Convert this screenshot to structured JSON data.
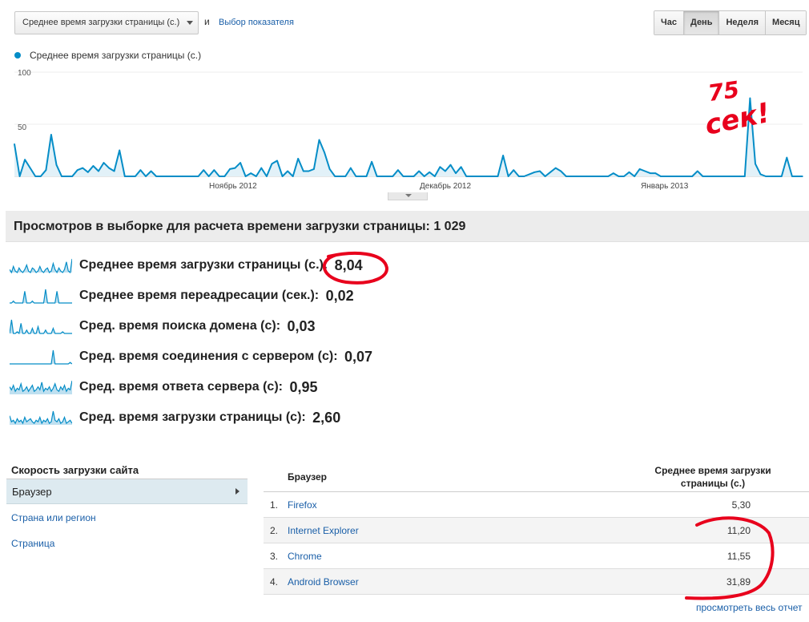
{
  "toolbar": {
    "metric_select": "Среднее время загрузки страницы (с.)",
    "and": "и",
    "choose_metric": "Выбор показателя",
    "periods": [
      "Час",
      "День",
      "Неделя",
      "Месяц"
    ],
    "active_period": "День"
  },
  "chart": {
    "legend": "Среднее время загрузки страницы (с.)",
    "series_color": "#058dc7",
    "fill_color": "#e2f1f8",
    "chart_data": {
      "type": "area",
      "series": [
        {
          "name": "Среднее время загрузки страницы (с.)",
          "values": [
            31,
            0,
            16,
            8,
            0,
            0,
            6,
            40,
            11,
            0,
            0,
            0,
            6,
            8,
            4,
            10,
            5,
            13,
            8,
            5,
            25,
            0,
            0,
            0,
            6,
            0,
            5,
            0,
            0,
            0,
            0,
            0,
            0,
            0,
            0,
            0,
            6,
            0,
            6,
            0,
            0,
            7,
            8,
            13,
            0,
            3,
            0,
            8,
            0,
            12,
            15,
            0,
            5,
            0,
            17,
            5,
            5,
            7,
            35,
            23,
            7,
            0,
            0,
            0,
            8,
            0,
            0,
            0,
            14,
            0,
            0,
            0,
            0,
            6,
            0,
            0,
            0,
            5,
            0,
            4,
            0,
            9,
            5,
            11,
            3,
            9,
            0,
            0,
            0,
            0,
            0,
            0,
            0,
            20,
            0,
            6,
            0,
            0,
            2,
            4,
            5,
            0,
            4,
            8,
            5,
            0,
            0,
            0,
            0,
            0,
            0,
            0,
            0,
            0,
            3,
            0,
            0,
            4,
            0,
            7,
            5,
            3,
            3,
            0,
            0,
            0,
            0,
            0,
            0,
            0,
            5,
            0,
            0,
            0,
            0,
            0,
            0,
            0,
            0,
            0,
            75,
            12,
            2,
            0,
            0,
            0,
            0,
            18,
            0,
            0,
            0
          ]
        }
      ],
      "ylim": [
        0,
        100
      ],
      "yticks": [
        "100",
        "50"
      ],
      "xticks": [
        "Ноябрь 2012",
        "Декабрь 2012",
        "Январь 2013"
      ]
    }
  },
  "views_header": "Просмотров в выборке для расчета времени загрузки страницы: 1 029",
  "metrics": [
    {
      "label": "Среднее время загрузки страницы (с.): ",
      "value": "8,04",
      "spark": [
        2,
        0,
        4,
        1,
        0,
        3,
        1,
        0,
        2,
        5,
        1,
        0,
        3,
        2,
        0,
        1,
        4,
        1,
        0,
        2,
        3,
        0,
        1,
        6,
        2,
        0,
        3,
        1,
        0,
        2,
        7,
        1,
        0,
        9
      ]
    },
    {
      "label": "Среднее время переадресации (сек.): ",
      "value": "0,02",
      "spark": [
        0,
        0,
        1,
        0,
        0,
        0,
        0,
        0,
        6,
        0,
        0,
        0,
        1,
        0,
        0,
        0,
        0,
        0,
        0,
        7,
        0,
        0,
        0,
        0,
        0,
        6,
        0,
        0,
        0,
        0,
        0,
        0,
        0,
        0
      ]
    },
    {
      "label": "Сред. время поиска домена (с): ",
      "value": "0,03",
      "spark": [
        0,
        8,
        0,
        0,
        1,
        0,
        6,
        0,
        0,
        2,
        0,
        0,
        3,
        0,
        0,
        4,
        0,
        0,
        0,
        2,
        0,
        0,
        0,
        3,
        0,
        0,
        0,
        0,
        1,
        0,
        0,
        0,
        0,
        0
      ]
    },
    {
      "label": "Сред. время соединения с сервером (с): ",
      "value": "0,07",
      "spark": [
        0,
        0,
        0,
        0,
        0,
        0,
        0,
        0,
        0,
        0,
        0,
        0,
        0,
        0,
        0,
        0,
        0,
        0,
        0,
        0,
        0,
        0,
        0,
        9,
        0,
        0,
        0,
        0,
        0,
        0,
        0,
        0,
        1,
        0
      ]
    },
    {
      "label": "Сред. время ответа сервера (с): ",
      "value": "0,95",
      "spark": [
        5,
        3,
        6,
        2,
        4,
        3,
        7,
        2,
        3,
        5,
        2,
        4,
        6,
        2,
        3,
        5,
        3,
        8,
        2,
        4,
        3,
        5,
        2,
        4,
        7,
        3,
        2,
        5,
        3,
        6,
        2,
        4,
        3,
        9
      ]
    },
    {
      "label": "Сред. время загрузки страницы (с): ",
      "value": "2,60",
      "spark": [
        6,
        2,
        3,
        1,
        4,
        2,
        3,
        1,
        5,
        2,
        3,
        4,
        2,
        1,
        3,
        2,
        5,
        1,
        3,
        2,
        4,
        1,
        2,
        9,
        3,
        2,
        4,
        1,
        2,
        5,
        1,
        2,
        3,
        1
      ]
    }
  ],
  "nav": {
    "title": "Скорость загрузки сайта",
    "items": [
      "Браузер",
      "Страна или регион",
      "Страница"
    ]
  },
  "table": {
    "col_browser": "Браузер",
    "col_metric": "Среднее время загрузки страницы (с.)",
    "rows": [
      {
        "idx": "1.",
        "name": "Firefox",
        "value": "5,30"
      },
      {
        "idx": "2.",
        "name": "Internet Explorer",
        "value": "11,20"
      },
      {
        "idx": "3.",
        "name": "Chrome",
        "value": "11,55"
      },
      {
        "idx": "4.",
        "name": "Android Browser",
        "value": "31,89"
      }
    ],
    "view_full_report": "просмотреть весь отчет"
  },
  "annotations": {
    "handwritten_note_top": "75",
    "handwritten_note_bottom": "сек!",
    "ink_color": "#e8001c"
  }
}
